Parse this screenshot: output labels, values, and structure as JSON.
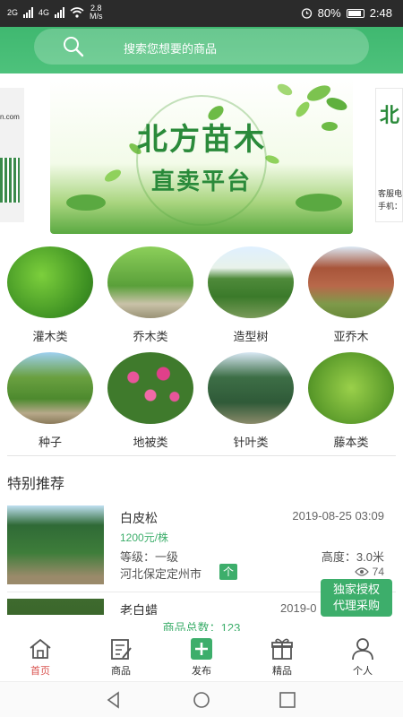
{
  "status_bar": {
    "network_1": "2G",
    "network_2": "4G",
    "speed_value": "2.8",
    "speed_unit": "M/s",
    "battery": "80%",
    "time": "2:48"
  },
  "search": {
    "placeholder": "搜索您想要的商品"
  },
  "banner": {
    "title_line1": "北方苗木",
    "title_line2": "直卖平台",
    "left_peek_url": "n.com",
    "right_peek_title": "北",
    "right_peek_lines": [
      "客服电",
      "手机："
    ]
  },
  "categories": [
    {
      "label": "灌木类",
      "icon": "shrub"
    },
    {
      "label": "乔木类",
      "icon": "tree"
    },
    {
      "label": "造型树",
      "icon": "topiary"
    },
    {
      "label": "亚乔木",
      "icon": "sub-tree"
    },
    {
      "label": "种子",
      "icon": "seed"
    },
    {
      "label": "地被类",
      "icon": "groundcover"
    },
    {
      "label": "针叶类",
      "icon": "conifer"
    },
    {
      "label": "藤本类",
      "icon": "vine"
    }
  ],
  "section_title": "特别推荐",
  "products": [
    {
      "name": "白皮松",
      "date": "2019-08-25 03:09",
      "price": "1200元/株",
      "grade": "等级：一级",
      "height": "高度：3.0米",
      "location": "河北保定定州市",
      "location_btn": "个",
      "views": "74"
    },
    {
      "name": "老白蜡",
      "date": "2019-0"
    }
  ],
  "float_button": {
    "line1": "独家授权",
    "line2": "代理采购"
  },
  "total": "商品总数：123",
  "bottom_nav": [
    {
      "label": "首页",
      "icon": "home-icon",
      "active": true
    },
    {
      "label": "商品",
      "icon": "goods-icon",
      "active": false
    },
    {
      "label": "发布",
      "icon": "publish-icon",
      "active": false
    },
    {
      "label": "精品",
      "icon": "gift-icon",
      "active": false
    },
    {
      "label": "个人",
      "icon": "user-icon",
      "active": false
    }
  ],
  "colors": {
    "brand_green": "#3dae6b",
    "active_red": "#d9534f"
  }
}
